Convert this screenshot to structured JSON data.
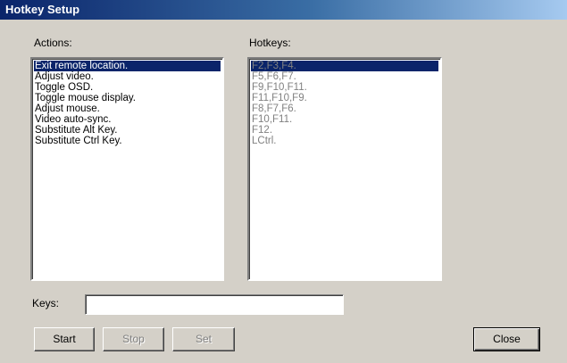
{
  "window": {
    "title": "Hotkey Setup"
  },
  "actions": {
    "label": "Actions:",
    "items": [
      "Exit remote location.",
      "Adjust video.",
      "Toggle OSD.",
      "Toggle mouse display.",
      "Adjust mouse.",
      "Video auto-sync.",
      "Substitute Alt Key.",
      "Substitute Ctrl Key."
    ],
    "selected_index": 0
  },
  "hotkeys": {
    "label": "Hotkeys:",
    "items": [
      "F2,F3,F4.",
      "F5,F6,F7.",
      "F9,F10,F11.",
      "F11,F10,F9.",
      "F8,F7,F6.",
      "F10,F11.",
      "F12.",
      "LCtrl."
    ],
    "selected_index": 0,
    "disabled": true
  },
  "keys": {
    "label": "Keys:",
    "value": ""
  },
  "buttons": {
    "start": "Start",
    "stop": "Stop",
    "set": "Set",
    "close": "Close"
  },
  "colors": {
    "title_gradient_start": "#0a246a",
    "title_gradient_end": "#a6caf0",
    "dialog_face": "#d4d0c8",
    "selection": "#0a246a",
    "disabled_text": "#808080"
  }
}
